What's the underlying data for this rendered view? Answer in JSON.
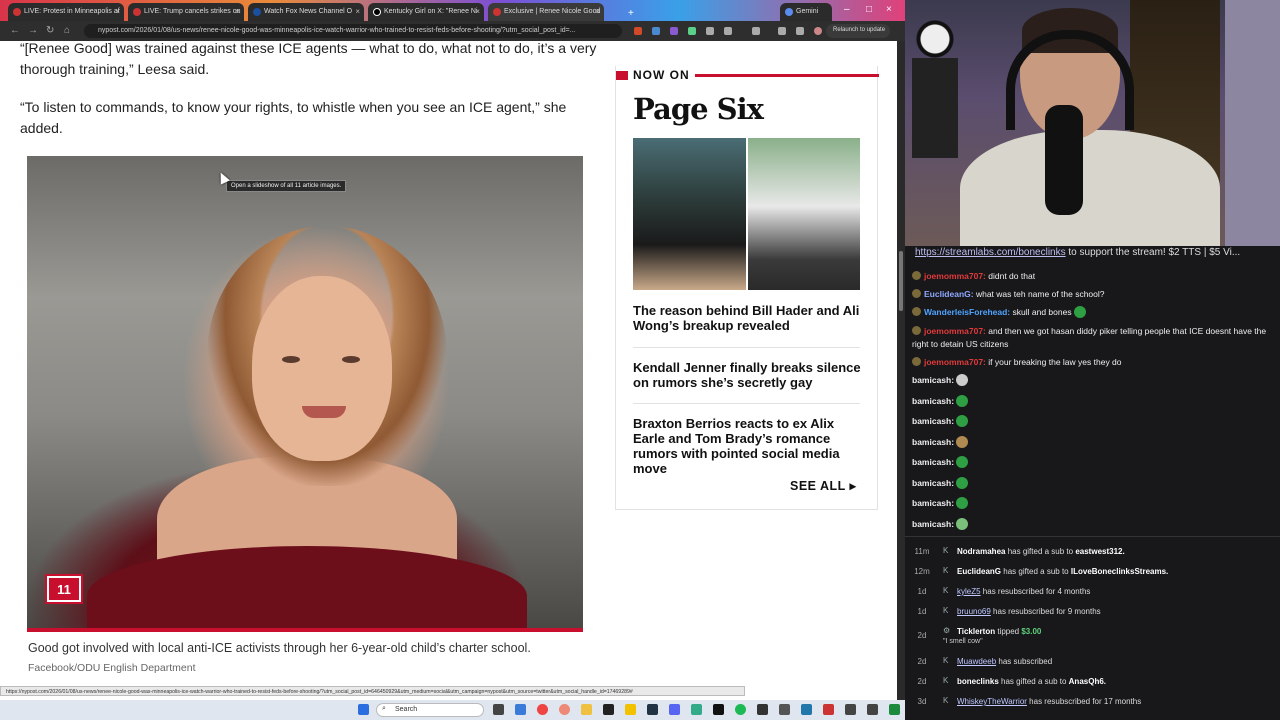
{
  "browser": {
    "tabs": [
      {
        "label": "LIVE: Protest in Minneapolis af"
      },
      {
        "label": "LIVE: Trump cancels strikes on"
      },
      {
        "label": "Watch Fox News Channel O"
      },
      {
        "label": "Kentucky Girl on X: \"Renee Ni"
      },
      {
        "label": "Exclusive | Renee Nicole Good"
      },
      {
        "label": "Gemini"
      }
    ],
    "url": "nypost.com/2026/01/08/us-news/renee-nicole-good-was-minneapolis-ice-watch-warrior-who-trained-to-resist-feds-before-shooting/?utm_social_post_id=...",
    "relaunch_label": "Relaunch to update",
    "status_url": "https://nypost.com/2026/01/08/us-news/renee-nicole-good-was-minneapolis-ice-watch-warrior-who-trained-to-resist-feds-before-shooting/?utm_social_post_id=646450929&utm_medium=social&utm_campaign=nypost&utm_source=twitter&utm_social_handle_id=17469289#"
  },
  "article": {
    "para1": "“[Renee Good] was trained against these ICE agents — what to do, what not to do, it’s a very thorough training,” Leesa said.",
    "para2": "“To listen to commands, to know your rights, to whistle when you see an ICE agent,” she added.",
    "tooltip": "Open a slideshow of all 11 article images.",
    "slideshow_count": "11",
    "caption": "Good got involved with local anti-ICE activists through her 6-year-old child’s charter school.",
    "credit": "Facebook/ODU English Department"
  },
  "sidebar": {
    "header": "NOW ON",
    "brand": "Page Six",
    "stories": [
      "The reason behind Bill Hader and Ali Wong’s breakup revealed",
      "Kendall Jenner finally breaks silence on rumors she’s secretly gay",
      "Braxton Berrios reacts to ex Alix Earle and Tom Brady’s romance rumors with pointed social media move"
    ],
    "see_all": "SEE ALL"
  },
  "taskbar": {
    "search_label": "Search"
  },
  "chat": {
    "pinned_link": "https://streamlabs.com/boneclinks",
    "pinned_rest": "to support the stream! $2 TTS | $5 Vi...",
    "messages": [
      {
        "user": "joemomma707:",
        "text": "didnt do that",
        "color": "#e03a3a"
      },
      {
        "user": "EuclideanG:",
        "text": "what was teh name of the school?",
        "color": "#8fa8ff"
      },
      {
        "user": "WanderleisForehead:",
        "text": "skull and bones",
        "color": "#4fa3ff"
      },
      {
        "user": "joemomma707:",
        "text": "and then we got hasan diddy piker telling people that ICE doesnt have the right to detain US citizens",
        "color": "#e03a3a"
      },
      {
        "user": "joemomma707:",
        "text": "if your breaking the law yes they do",
        "color": "#e03a3a"
      },
      {
        "user": "bamicash:",
        "text": "",
        "color": "#e6e6e6"
      },
      {
        "user": "bamicash:",
        "text": "",
        "color": "#e6e6e6"
      },
      {
        "user": "bamicash:",
        "text": "",
        "color": "#e6e6e6"
      },
      {
        "user": "bamicash:",
        "text": "",
        "color": "#e6e6e6"
      },
      {
        "user": "bamicash:",
        "text": "",
        "color": "#e6e6e6"
      },
      {
        "user": "bamicash:",
        "text": "",
        "color": "#e6e6e6"
      },
      {
        "user": "bamicash:",
        "text": "",
        "color": "#e6e6e6"
      },
      {
        "user": "bamicash:",
        "text": "",
        "color": "#e6e6e6"
      }
    ],
    "events": [
      {
        "time": "11m",
        "user": "Nodramahea",
        "action": "has gifted a sub to",
        "target": "eastwest312."
      },
      {
        "time": "12m",
        "user": "EuclideanG",
        "action": "has gifted a sub to",
        "target": "ILoveBoneclinksStreams."
      },
      {
        "time": "1d",
        "user": "kyleZ5",
        "action": "has resubscribed for 4 months",
        "target": ""
      },
      {
        "time": "1d",
        "user": "bruuno69",
        "action": "has resubscribed for 9 months",
        "target": ""
      },
      {
        "time": "2d",
        "user": "Ticklerton",
        "action": "tipped",
        "target": "$3.00",
        "note": "\"I smell cow\""
      },
      {
        "time": "2d",
        "user": "Muawdeeb",
        "action": "has subscribed",
        "target": ""
      },
      {
        "time": "2d",
        "user": "boneclinks",
        "action": "has gifted a sub to",
        "target": "AnasQh6."
      },
      {
        "time": "3d",
        "user": "WhiskeyTheWarrior",
        "action": "has resubscribed for 17 months",
        "target": ""
      }
    ]
  }
}
